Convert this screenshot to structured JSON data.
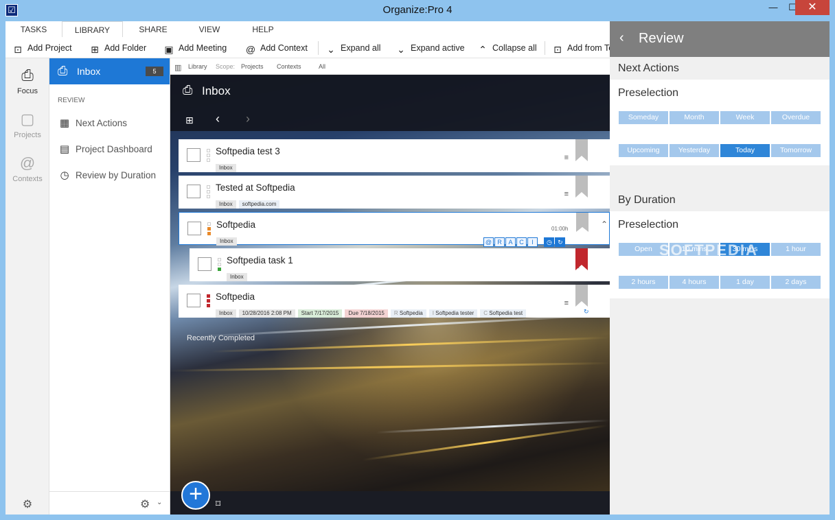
{
  "window": {
    "title": "Organize:Pro 4",
    "app_icon": "☑",
    "minimize": "—",
    "maximize": "☐",
    "close": "✕"
  },
  "menu": {
    "tabs": [
      "TASKS",
      "LIBRARY",
      "SHARE",
      "VIEW",
      "HELP"
    ]
  },
  "toolbar": {
    "add_project": "Add Project",
    "add_folder": "Add Folder",
    "add_meeting": "Add Meeting",
    "add_context": "Add Context",
    "expand_all": "Expand all",
    "expand_active": "Expand active",
    "collapse_all": "Collapse all",
    "add_from": "Add from Te"
  },
  "nav": {
    "focus": "Focus",
    "projects": "Projects",
    "contexts": "Contexts"
  },
  "library": {
    "inbox_label": "Inbox",
    "inbox_count": "5",
    "review_header": "REVIEW",
    "items": [
      "Next Actions",
      "Project Dashboard",
      "Review by Duration"
    ]
  },
  "scope": {
    "library": "Library",
    "scope_label": "Scope:",
    "projects": "Projects",
    "contexts": "Contexts",
    "all": "All"
  },
  "main": {
    "title": "Inbox",
    "recently_completed": "Recently Completed"
  },
  "tasks": [
    {
      "title": "Softpedia test 3",
      "tags": [
        "Inbox"
      ]
    },
    {
      "title": "Tested at Softpedia",
      "tags": [
        "Inbox",
        "softpedia.com"
      ]
    },
    {
      "title": "Softpedia",
      "tags": [
        "Inbox"
      ],
      "duration": "01:00h"
    },
    {
      "title": "Softpedia task 1",
      "tags": [
        "Inbox"
      ]
    },
    {
      "title": "Softpedia",
      "tags": [
        "Inbox",
        "10/28/2016 2:08 PM",
        "Start 7/17/2015",
        "Due 7/18/2015",
        "Softpedia",
        "Softpedia tester",
        "Softpedia test"
      ],
      "tag_prefixes": [
        "",
        "",
        "",
        "",
        "R",
        "I",
        "C"
      ]
    }
  ],
  "raci": {
    "letters": [
      "@",
      "R",
      "A",
      "C",
      "I"
    ]
  },
  "review": {
    "title": "Review",
    "next_actions": "Next Actions",
    "preselection1": "Preselection",
    "chips1": [
      "Someday",
      "Month",
      "Week",
      "Overdue",
      "Upcoming",
      "Yesterday",
      "Today",
      "Tomorrow"
    ],
    "selected1": "Today",
    "by_duration": "By Duration",
    "preselection2": "Preselection",
    "chips2": [
      "Open",
      "10 mins",
      "30 mins",
      "1 hour",
      "2 hours",
      "4 hours",
      "1 day",
      "2 days"
    ],
    "selected2": "30 mins"
  },
  "watermark": "SOFTPEDIA"
}
